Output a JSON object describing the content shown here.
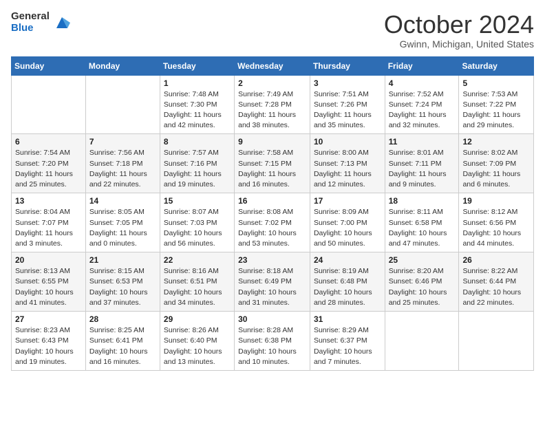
{
  "header": {
    "logo_general": "General",
    "logo_blue": "Blue",
    "month_title": "October 2024",
    "location": "Gwinn, Michigan, United States"
  },
  "days_of_week": [
    "Sunday",
    "Monday",
    "Tuesday",
    "Wednesday",
    "Thursday",
    "Friday",
    "Saturday"
  ],
  "weeks": [
    [
      {
        "num": "",
        "info": ""
      },
      {
        "num": "",
        "info": ""
      },
      {
        "num": "1",
        "info": "Sunrise: 7:48 AM\nSunset: 7:30 PM\nDaylight: 11 hours and 42 minutes."
      },
      {
        "num": "2",
        "info": "Sunrise: 7:49 AM\nSunset: 7:28 PM\nDaylight: 11 hours and 38 minutes."
      },
      {
        "num": "3",
        "info": "Sunrise: 7:51 AM\nSunset: 7:26 PM\nDaylight: 11 hours and 35 minutes."
      },
      {
        "num": "4",
        "info": "Sunrise: 7:52 AM\nSunset: 7:24 PM\nDaylight: 11 hours and 32 minutes."
      },
      {
        "num": "5",
        "info": "Sunrise: 7:53 AM\nSunset: 7:22 PM\nDaylight: 11 hours and 29 minutes."
      }
    ],
    [
      {
        "num": "6",
        "info": "Sunrise: 7:54 AM\nSunset: 7:20 PM\nDaylight: 11 hours and 25 minutes."
      },
      {
        "num": "7",
        "info": "Sunrise: 7:56 AM\nSunset: 7:18 PM\nDaylight: 11 hours and 22 minutes."
      },
      {
        "num": "8",
        "info": "Sunrise: 7:57 AM\nSunset: 7:16 PM\nDaylight: 11 hours and 19 minutes."
      },
      {
        "num": "9",
        "info": "Sunrise: 7:58 AM\nSunset: 7:15 PM\nDaylight: 11 hours and 16 minutes."
      },
      {
        "num": "10",
        "info": "Sunrise: 8:00 AM\nSunset: 7:13 PM\nDaylight: 11 hours and 12 minutes."
      },
      {
        "num": "11",
        "info": "Sunrise: 8:01 AM\nSunset: 7:11 PM\nDaylight: 11 hours and 9 minutes."
      },
      {
        "num": "12",
        "info": "Sunrise: 8:02 AM\nSunset: 7:09 PM\nDaylight: 11 hours and 6 minutes."
      }
    ],
    [
      {
        "num": "13",
        "info": "Sunrise: 8:04 AM\nSunset: 7:07 PM\nDaylight: 11 hours and 3 minutes."
      },
      {
        "num": "14",
        "info": "Sunrise: 8:05 AM\nSunset: 7:05 PM\nDaylight: 11 hours and 0 minutes."
      },
      {
        "num": "15",
        "info": "Sunrise: 8:07 AM\nSunset: 7:03 PM\nDaylight: 10 hours and 56 minutes."
      },
      {
        "num": "16",
        "info": "Sunrise: 8:08 AM\nSunset: 7:02 PM\nDaylight: 10 hours and 53 minutes."
      },
      {
        "num": "17",
        "info": "Sunrise: 8:09 AM\nSunset: 7:00 PM\nDaylight: 10 hours and 50 minutes."
      },
      {
        "num": "18",
        "info": "Sunrise: 8:11 AM\nSunset: 6:58 PM\nDaylight: 10 hours and 47 minutes."
      },
      {
        "num": "19",
        "info": "Sunrise: 8:12 AM\nSunset: 6:56 PM\nDaylight: 10 hours and 44 minutes."
      }
    ],
    [
      {
        "num": "20",
        "info": "Sunrise: 8:13 AM\nSunset: 6:55 PM\nDaylight: 10 hours and 41 minutes."
      },
      {
        "num": "21",
        "info": "Sunrise: 8:15 AM\nSunset: 6:53 PM\nDaylight: 10 hours and 37 minutes."
      },
      {
        "num": "22",
        "info": "Sunrise: 8:16 AM\nSunset: 6:51 PM\nDaylight: 10 hours and 34 minutes."
      },
      {
        "num": "23",
        "info": "Sunrise: 8:18 AM\nSunset: 6:49 PM\nDaylight: 10 hours and 31 minutes."
      },
      {
        "num": "24",
        "info": "Sunrise: 8:19 AM\nSunset: 6:48 PM\nDaylight: 10 hours and 28 minutes."
      },
      {
        "num": "25",
        "info": "Sunrise: 8:20 AM\nSunset: 6:46 PM\nDaylight: 10 hours and 25 minutes."
      },
      {
        "num": "26",
        "info": "Sunrise: 8:22 AM\nSunset: 6:44 PM\nDaylight: 10 hours and 22 minutes."
      }
    ],
    [
      {
        "num": "27",
        "info": "Sunrise: 8:23 AM\nSunset: 6:43 PM\nDaylight: 10 hours and 19 minutes."
      },
      {
        "num": "28",
        "info": "Sunrise: 8:25 AM\nSunset: 6:41 PM\nDaylight: 10 hours and 16 minutes."
      },
      {
        "num": "29",
        "info": "Sunrise: 8:26 AM\nSunset: 6:40 PM\nDaylight: 10 hours and 13 minutes."
      },
      {
        "num": "30",
        "info": "Sunrise: 8:28 AM\nSunset: 6:38 PM\nDaylight: 10 hours and 10 minutes."
      },
      {
        "num": "31",
        "info": "Sunrise: 8:29 AM\nSunset: 6:37 PM\nDaylight: 10 hours and 7 minutes."
      },
      {
        "num": "",
        "info": ""
      },
      {
        "num": "",
        "info": ""
      }
    ]
  ]
}
